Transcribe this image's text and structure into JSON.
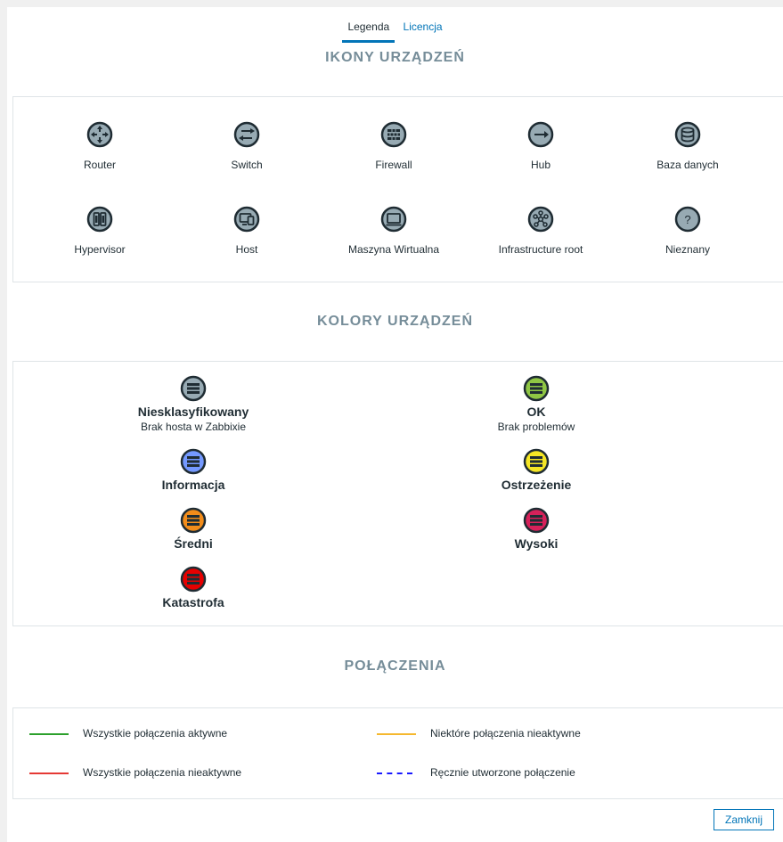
{
  "tabs": [
    {
      "label": "Legenda",
      "active": true
    },
    {
      "label": "Licencja",
      "active": false
    }
  ],
  "sections": {
    "icons_title": "IKONY URZĄDZEŃ",
    "colors_title": "KOLORY URZĄDZEŃ",
    "connections_title": "POŁĄCZENIA"
  },
  "device_icons": [
    {
      "label": "Router",
      "icon": "router-icon"
    },
    {
      "label": "Switch",
      "icon": "switch-icon"
    },
    {
      "label": "Firewall",
      "icon": "firewall-icon"
    },
    {
      "label": "Hub",
      "icon": "hub-icon"
    },
    {
      "label": "Baza danych",
      "icon": "database-icon"
    },
    {
      "label": "Hypervisor",
      "icon": "hypervisor-icon"
    },
    {
      "label": "Host",
      "icon": "host-icon"
    },
    {
      "label": "Maszyna Wirtualna",
      "icon": "virtual-machine-icon"
    },
    {
      "label": "Infrastructure root",
      "icon": "infrastructure-root-icon"
    },
    {
      "label": "Nieznany",
      "icon": "unknown-icon"
    }
  ],
  "device_colors": [
    {
      "name": "Niesklasyfikowany",
      "desc": "Brak hosta w Zabbixie",
      "color": "#97aab3"
    },
    {
      "name": "OK",
      "desc": "Brak problemów",
      "color": "#59db8f"
    },
    {
      "name": "Informacja",
      "desc": "",
      "color": "#7499ff"
    },
    {
      "name": "Ostrzeżenie",
      "desc": "",
      "color": "#ffc859"
    },
    {
      "name": "Średni",
      "desc": "",
      "color": "#ffa059"
    },
    {
      "name": "Wysoki",
      "desc": "",
      "color": "#e97659"
    },
    {
      "name": "Katastrofa",
      "desc": "",
      "color": "#e45959"
    }
  ],
  "icon_fill_colors": [
    "#97aab3",
    "#8fc644",
    "#7499ff",
    "#f5e625",
    "#f28c1a",
    "#d6215a",
    "#e60000"
  ],
  "connections": [
    {
      "label": "Wszystkie połączenia aktywne",
      "color": "#2ca02c",
      "style": "solid"
    },
    {
      "label": "Niektóre połączenia nieaktywne",
      "color": "#f5b82e",
      "style": "solid"
    },
    {
      "label": "Wszystkie połączenia nieaktywne",
      "color": "#e53935",
      "style": "solid"
    },
    {
      "label": "Ręcznie utworzone połączenie",
      "color": "#1a1aff",
      "style": "dashed"
    }
  ],
  "close_button": {
    "label": "Zamknij"
  }
}
